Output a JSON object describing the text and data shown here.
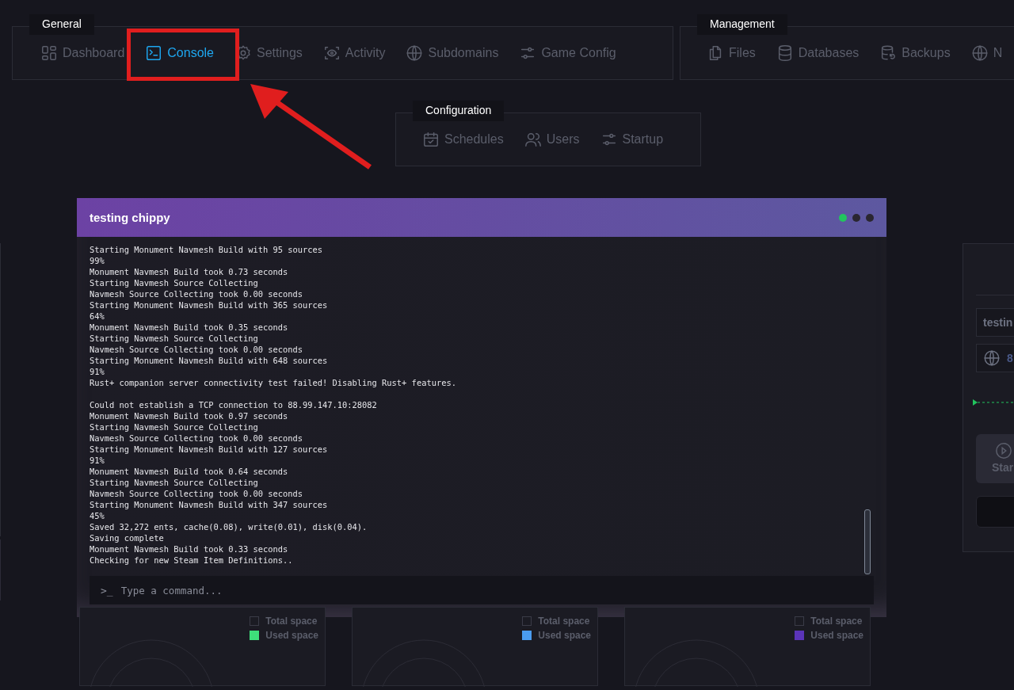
{
  "nav_groups": [
    {
      "title": "General",
      "items": [
        {
          "label": "Dashboard",
          "selected": false
        },
        {
          "label": "Console",
          "selected": true
        },
        {
          "label": "Settings",
          "selected": false
        },
        {
          "label": "Activity",
          "selected": false
        },
        {
          "label": "Subdomains",
          "selected": false
        },
        {
          "label": "Game Config",
          "selected": false
        }
      ]
    },
    {
      "title": "Management",
      "items": [
        {
          "label": "Files",
          "selected": false
        },
        {
          "label": "Databases",
          "selected": false
        },
        {
          "label": "Backups",
          "selected": false
        },
        {
          "label": "N",
          "selected": false
        }
      ]
    },
    {
      "title": "Configuration",
      "items": [
        {
          "label": "Schedules",
          "selected": false
        },
        {
          "label": "Users",
          "selected": false
        },
        {
          "label": "Startup",
          "selected": false
        }
      ]
    }
  ],
  "console": {
    "title": "testing chippy",
    "status_dots": [
      {
        "color": "#22c55e"
      },
      {
        "color": "#2a2630"
      },
      {
        "color": "#2a2630"
      }
    ],
    "log_blocks": [
      [
        "Starting Monument Navmesh Build with 95 sources",
        "99%",
        "Monument Navmesh Build took 0.73 seconds",
        "Starting Navmesh Source Collecting",
        "Navmesh Source Collecting took 0.00 seconds",
        "Starting Monument Navmesh Build with 365 sources",
        "64%",
        "Monument Navmesh Build took 0.35 seconds",
        "Starting Navmesh Source Collecting",
        "Navmesh Source Collecting took 0.00 seconds",
        "Starting Monument Navmesh Build with 648 sources",
        "91%",
        "Rust+ companion server connectivity test failed! Disabling Rust+ features."
      ],
      [
        "Could not establish a TCP connection to 88.99.147.10:28082",
        "Monument Navmesh Build took 0.97 seconds",
        "Starting Navmesh Source Collecting",
        "Navmesh Source Collecting took 0.00 seconds",
        "Starting Monument Navmesh Build with 127 sources",
        "91%",
        "Monument Navmesh Build took 0.64 seconds",
        "Starting Navmesh Source Collecting",
        "Navmesh Source Collecting took 0.00 seconds",
        "Starting Monument Navmesh Build with 347 sources",
        "45%",
        "Saved 32,272 ents, cache(0.08), write(0.01), disk(0.04).",
        "Saving complete",
        "Monument Navmesh Build took 0.33 seconds",
        "Checking for new Steam Item Definitions.."
      ]
    ],
    "command": {
      "prompt": ">_",
      "placeholder": "Type a command..."
    }
  },
  "server_panel": {
    "name_field": "testin",
    "address_field": "8",
    "start_button": "Star"
  },
  "storage_cards": [
    {
      "legend": [
        {
          "label": "Total space"
        },
        {
          "label": "Used space",
          "color": "#3ee07a"
        }
      ]
    },
    {
      "legend": [
        {
          "label": "Total space"
        },
        {
          "label": "Used space",
          "color": "#4a9cf0"
        }
      ]
    },
    {
      "legend": [
        {
          "label": "Total space"
        },
        {
          "label": "Used space",
          "color": "#5b34b8"
        }
      ]
    }
  ]
}
